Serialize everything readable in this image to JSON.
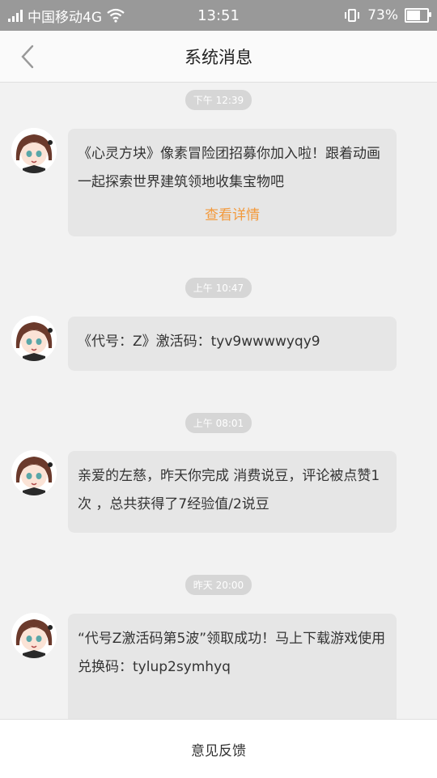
{
  "status_bar": {
    "carrier": "中国移动4G",
    "time": "13:51",
    "battery_percent": "73%",
    "battery_level": 0.73
  },
  "header": {
    "title": "系统消息"
  },
  "messages": [
    {
      "time": "下午 12:39",
      "text": "《心灵方块》像素冒险团招募你加入啦！跟着动画一起探索世界建筑领地收集宝物吧",
      "link": "查看详情"
    },
    {
      "time": "上午 10:47",
      "text": "《代号：Z》激活码：tyv9wwwwyqy9"
    },
    {
      "time": "上午 08:01",
      "text": "亲爱的左慈，昨天你完成  消费说豆，评论被点赞1次 ，总共获得了7经验值/2说豆"
    },
    {
      "time": "昨天 20:00",
      "text": "“代号Z激活码第5波”领取成功！马上下载游戏使用兑换码：tylup2symhyq"
    }
  ],
  "footer": {
    "feedback": "意见反馈"
  },
  "colors": {
    "accent": "#f39a3d",
    "status_bar_bg": "#999999",
    "bubble_bg": "#e6e6e6",
    "time_pill_bg": "#d6d6d6"
  }
}
